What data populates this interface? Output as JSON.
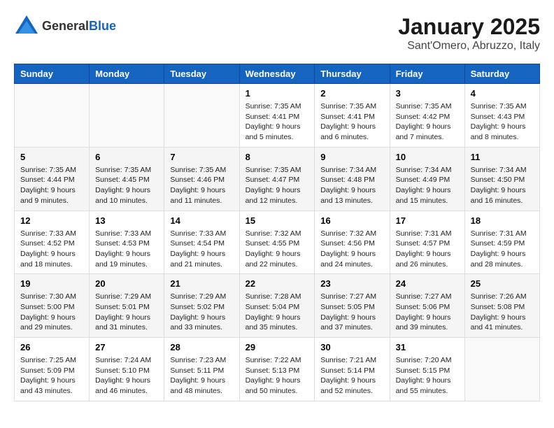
{
  "header": {
    "logo_general": "General",
    "logo_blue": "Blue",
    "month_title": "January 2025",
    "location": "Sant'Omero, Abruzzo, Italy"
  },
  "weekdays": [
    "Sunday",
    "Monday",
    "Tuesday",
    "Wednesday",
    "Thursday",
    "Friday",
    "Saturday"
  ],
  "weeks": [
    [
      {
        "day": "",
        "info": ""
      },
      {
        "day": "",
        "info": ""
      },
      {
        "day": "",
        "info": ""
      },
      {
        "day": "1",
        "info": "Sunrise: 7:35 AM\nSunset: 4:41 PM\nDaylight: 9 hours\nand 5 minutes."
      },
      {
        "day": "2",
        "info": "Sunrise: 7:35 AM\nSunset: 4:41 PM\nDaylight: 9 hours\nand 6 minutes."
      },
      {
        "day": "3",
        "info": "Sunrise: 7:35 AM\nSunset: 4:42 PM\nDaylight: 9 hours\nand 7 minutes."
      },
      {
        "day": "4",
        "info": "Sunrise: 7:35 AM\nSunset: 4:43 PM\nDaylight: 9 hours\nand 8 minutes."
      }
    ],
    [
      {
        "day": "5",
        "info": "Sunrise: 7:35 AM\nSunset: 4:44 PM\nDaylight: 9 hours\nand 9 minutes."
      },
      {
        "day": "6",
        "info": "Sunrise: 7:35 AM\nSunset: 4:45 PM\nDaylight: 9 hours\nand 10 minutes."
      },
      {
        "day": "7",
        "info": "Sunrise: 7:35 AM\nSunset: 4:46 PM\nDaylight: 9 hours\nand 11 minutes."
      },
      {
        "day": "8",
        "info": "Sunrise: 7:35 AM\nSunset: 4:47 PM\nDaylight: 9 hours\nand 12 minutes."
      },
      {
        "day": "9",
        "info": "Sunrise: 7:34 AM\nSunset: 4:48 PM\nDaylight: 9 hours\nand 13 minutes."
      },
      {
        "day": "10",
        "info": "Sunrise: 7:34 AM\nSunset: 4:49 PM\nDaylight: 9 hours\nand 15 minutes."
      },
      {
        "day": "11",
        "info": "Sunrise: 7:34 AM\nSunset: 4:50 PM\nDaylight: 9 hours\nand 16 minutes."
      }
    ],
    [
      {
        "day": "12",
        "info": "Sunrise: 7:33 AM\nSunset: 4:52 PM\nDaylight: 9 hours\nand 18 minutes."
      },
      {
        "day": "13",
        "info": "Sunrise: 7:33 AM\nSunset: 4:53 PM\nDaylight: 9 hours\nand 19 minutes."
      },
      {
        "day": "14",
        "info": "Sunrise: 7:33 AM\nSunset: 4:54 PM\nDaylight: 9 hours\nand 21 minutes."
      },
      {
        "day": "15",
        "info": "Sunrise: 7:32 AM\nSunset: 4:55 PM\nDaylight: 9 hours\nand 22 minutes."
      },
      {
        "day": "16",
        "info": "Sunrise: 7:32 AM\nSunset: 4:56 PM\nDaylight: 9 hours\nand 24 minutes."
      },
      {
        "day": "17",
        "info": "Sunrise: 7:31 AM\nSunset: 4:57 PM\nDaylight: 9 hours\nand 26 minutes."
      },
      {
        "day": "18",
        "info": "Sunrise: 7:31 AM\nSunset: 4:59 PM\nDaylight: 9 hours\nand 28 minutes."
      }
    ],
    [
      {
        "day": "19",
        "info": "Sunrise: 7:30 AM\nSunset: 5:00 PM\nDaylight: 9 hours\nand 29 minutes."
      },
      {
        "day": "20",
        "info": "Sunrise: 7:29 AM\nSunset: 5:01 PM\nDaylight: 9 hours\nand 31 minutes."
      },
      {
        "day": "21",
        "info": "Sunrise: 7:29 AM\nSunset: 5:02 PM\nDaylight: 9 hours\nand 33 minutes."
      },
      {
        "day": "22",
        "info": "Sunrise: 7:28 AM\nSunset: 5:04 PM\nDaylight: 9 hours\nand 35 minutes."
      },
      {
        "day": "23",
        "info": "Sunrise: 7:27 AM\nSunset: 5:05 PM\nDaylight: 9 hours\nand 37 minutes."
      },
      {
        "day": "24",
        "info": "Sunrise: 7:27 AM\nSunset: 5:06 PM\nDaylight: 9 hours\nand 39 minutes."
      },
      {
        "day": "25",
        "info": "Sunrise: 7:26 AM\nSunset: 5:08 PM\nDaylight: 9 hours\nand 41 minutes."
      }
    ],
    [
      {
        "day": "26",
        "info": "Sunrise: 7:25 AM\nSunset: 5:09 PM\nDaylight: 9 hours\nand 43 minutes."
      },
      {
        "day": "27",
        "info": "Sunrise: 7:24 AM\nSunset: 5:10 PM\nDaylight: 9 hours\nand 46 minutes."
      },
      {
        "day": "28",
        "info": "Sunrise: 7:23 AM\nSunset: 5:11 PM\nDaylight: 9 hours\nand 48 minutes."
      },
      {
        "day": "29",
        "info": "Sunrise: 7:22 AM\nSunset: 5:13 PM\nDaylight: 9 hours\nand 50 minutes."
      },
      {
        "day": "30",
        "info": "Sunrise: 7:21 AM\nSunset: 5:14 PM\nDaylight: 9 hours\nand 52 minutes."
      },
      {
        "day": "31",
        "info": "Sunrise: 7:20 AM\nSunset: 5:15 PM\nDaylight: 9 hours\nand 55 minutes."
      },
      {
        "day": "",
        "info": ""
      }
    ]
  ]
}
